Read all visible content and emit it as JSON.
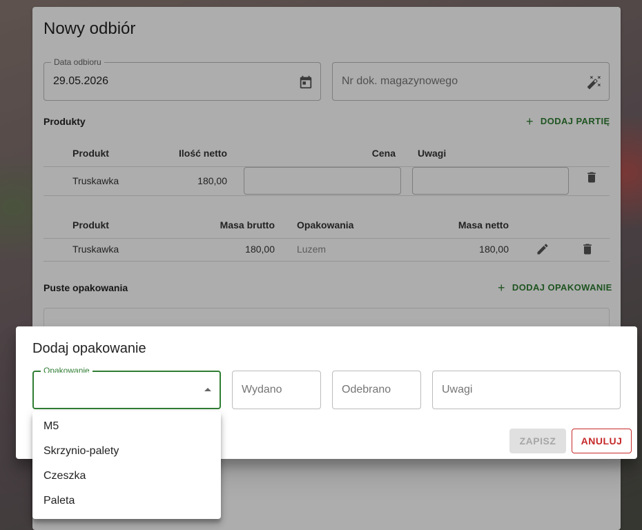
{
  "main": {
    "title": "Nowy odbiór",
    "date_field": {
      "label": "Data odbioru",
      "value": "29.05.2026",
      "icon": "calendar-icon"
    },
    "doc_field": {
      "placeholder": "Nr dok. magazynowego",
      "icon": "magic-wand-icon"
    },
    "products": {
      "title": "Produkty",
      "add_label": "DODAJ PARTIĘ",
      "headers": [
        "Produkt",
        "Ilość netto",
        "Cena",
        "Uwagi"
      ],
      "rows": [
        {
          "product": "Truskawka",
          "net_qty": "180,00"
        }
      ]
    },
    "batches": {
      "headers": [
        "Produkt",
        "Masa brutto",
        "Opakowania",
        "Masa netto"
      ],
      "rows": [
        {
          "product": "Truskawka",
          "gross": "180,00",
          "packaging": "Luzem",
          "net": "180,00"
        }
      ]
    },
    "empty_packaging": {
      "title": "Puste opakowania",
      "add_label": "DODAJ OPAKOWANIE"
    }
  },
  "dialog": {
    "title": "Dodaj opakowanie",
    "packaging_label": "Opakowanie",
    "issued_placeholder": "Wydano",
    "received_placeholder": "Odebrano",
    "notes_placeholder": "Uwagi",
    "save_label": "ZAPISZ",
    "cancel_label": "ANULUJ"
  },
  "menu": {
    "options": [
      "M5",
      "Skrzynio-palety",
      "Czeszka",
      "Paleta"
    ]
  },
  "colors": {
    "accent": "#2e7d32",
    "danger": "#c62828"
  }
}
